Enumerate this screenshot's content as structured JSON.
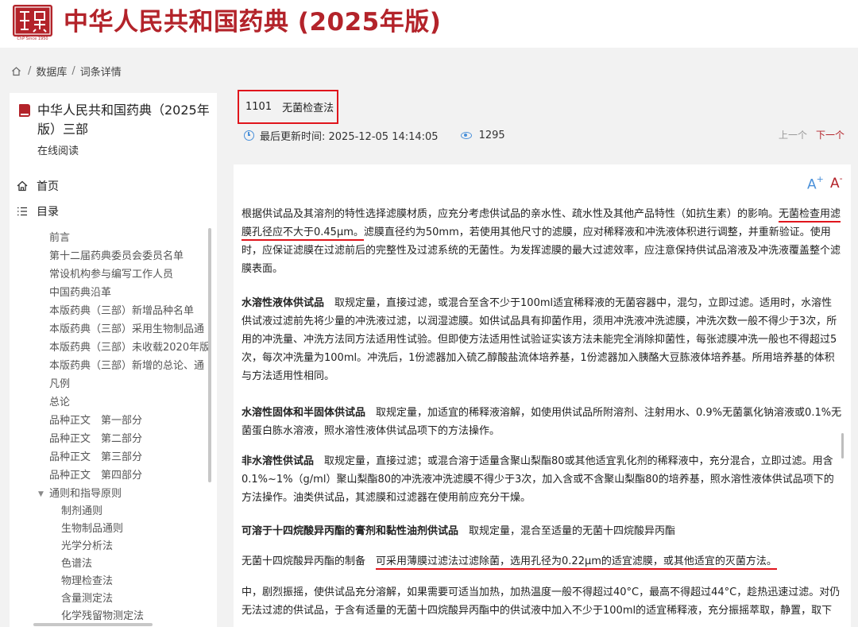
{
  "header": {
    "logo_caption": "ChP Since 1950",
    "title": "中华人民共和国药典 (2025年版)"
  },
  "breadcrumb": {
    "items": [
      "数据库",
      "词条详情"
    ]
  },
  "sidebar": {
    "book_title": "中华人民共和国药典（2025年版）三部",
    "book_subtitle": "在线阅读",
    "home_label": "首页",
    "toc_label": "目录",
    "toc_items": [
      "前言",
      "第十二届药典委员会委员名单",
      "常设机构参与编写工作人员",
      "中国药典沿革",
      "本版药典（三部）新增品种名单",
      "本版药典（三部）采用生物制品通",
      "本版药典（三部）未收载2020年版",
      "本版药典（三部）新增的总论、通",
      "凡例",
      "总论",
      "品种正文　第一部分",
      "品种正文　第二部分",
      "品种正文　第三部分",
      "品种正文　第四部分",
      "通则和指导原则"
    ],
    "toc_subitems": [
      "制剂通则",
      "生物制品通则",
      "光学分析法",
      "色谱法",
      "物理检查法",
      "含量测定法",
      "化学残留物测定法"
    ]
  },
  "entry": {
    "code": "1101",
    "name": "无菌检查法",
    "updated_label": "最后更新时间: 2025-12-05 14:14:05",
    "views": "1295",
    "prev_label": "上一个",
    "next_label": "下一个"
  },
  "content": {
    "font_increase": "A",
    "font_decrease": "A",
    "p1_a": "根据供试品及其溶剂的特性选择滤膜材质，应充分考虑供试品的亲水性、疏水性及其他产品特性（如抗生素）的影响。",
    "p1_hl1": "无菌检查用",
    "p1_hl2": "滤膜孔径应不大于0.45μm。",
    "p1_b": "滤膜直径约为50mm，若使用其他尺寸的滤膜，应对稀释液和冲洗液体积进行调整，并重新验证。使用时，应保证滤膜在过滤前后的完整性及过滤系统的无菌性。为发挥滤膜的最大过滤效率，应注意保持供试品溶液及冲洗液覆盖整个滤膜表面。",
    "p2_title": "水溶性液体供试品",
    "p2_text": "取规定量，直接过滤，或混合至含不少于100ml适宜稀释液的无菌容器中，混匀，立即过滤。适用时，水溶性供试液过滤前先将少量的冲洗液过滤，以润湿滤膜。如供试品具有抑菌作用，须用冲洗液冲洗滤膜，冲洗次数一般不得少于3次，所用的冲洗量、冲洗方法同方法适用性试验。但即使方法适用性试验证实该方法未能完全消除抑菌性，每张滤膜冲洗一般也不得超过5次，每次冲洗量为100ml。冲洗后，1份滤器加入硫乙醇酸盐流体培养基，1份滤器加入胰酪大豆胨液体培养基。所用培养基的体积与方法适用性相同。",
    "p3_title": "水溶性固体和半固体供试品",
    "p3_text": "取规定量，加适宜的稀释液溶解，如使用供试品所附溶剂、注射用水、0.9%无菌氯化钠溶液或0.1%无菌蛋白胨水溶液，照水溶性液体供试品项下的方法操作。",
    "p4_title": "非水溶性供试品",
    "p4_text": "取规定量，直接过滤；或混合溶于适量含聚山梨酯80或其他适宜乳化剂的稀释液中，充分混合，立即过滤。用含0.1%~1%（g/ml）聚山梨酯80的冲洗液冲洗滤膜不得少于3次，加入含或不含聚山梨酯80的培养基，照水溶性液体供试品项下的方法操作。油类供试品，其滤膜和过滤器在使用前应充分干燥。",
    "p5_title": "可溶于十四烷酸异丙酯的膏剂和黏性油剂供试品",
    "p5_text": "取规定量，混合至适量的无菌十四烷酸异丙酯",
    "p6_lead": "无菌十四烷酸异丙酯的制备",
    "p6_hl": "可采用薄膜过滤法过滤除菌，选用孔径为0.22μm的适宜滤膜，或其他适宜的灭菌方法。",
    "p7_text": "中，剧烈振摇，使供试品充分溶解，如果需要可适当加热，加热温度一般不得超过40°C，最高不得超过44°C，趁热迅速过滤。对仍无法过滤的供试品，于含有适量的无菌十四烷酸异丙酯中的供试液中加入不少于100ml的适宜稀释液，充分振摇萃取，静置，取下"
  },
  "colors": {
    "brand_red": "#b3232a",
    "highlight_red": "#e0151c",
    "accent_blue": "#4a90d9"
  }
}
